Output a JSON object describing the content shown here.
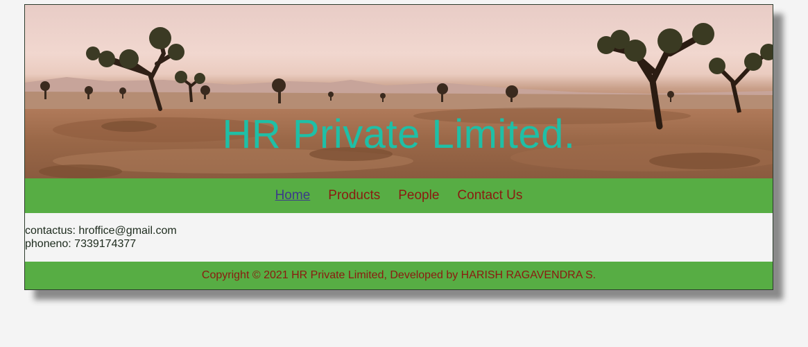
{
  "header": {
    "title": "HR Private Limited."
  },
  "nav": {
    "items": [
      {
        "label": "Home",
        "active": true
      },
      {
        "label": "Products",
        "active": false
      },
      {
        "label": "People",
        "active": false
      },
      {
        "label": "Contact Us",
        "active": false
      }
    ]
  },
  "contact": {
    "email_line": "contactus: hroffice@gmail.com",
    "phone_line": "phoneno: 7339174377"
  },
  "footer": {
    "text": "Copyright © 2021 HR Private Limited, Developed by HARISH RAGAVENDRA S."
  },
  "colors": {
    "nav_bg": "#57ad44",
    "link": "#8b1a10",
    "active_link": "#3c3a8a",
    "title": "#1fbfa6"
  }
}
